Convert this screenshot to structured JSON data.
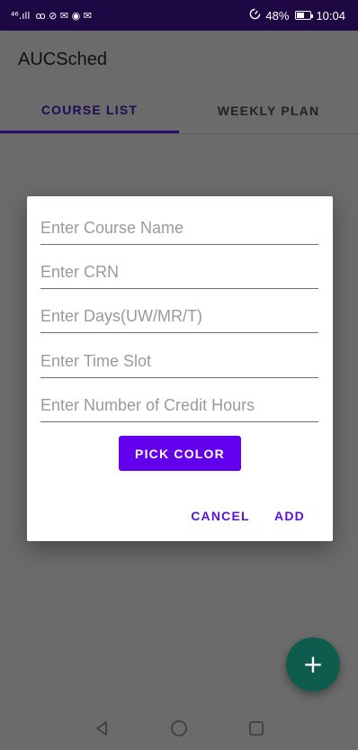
{
  "status_bar": {
    "network": "⁴⁶.ıll",
    "notification_icons": "ꝏ ⊘ ✉ ◉ ✉",
    "battery_percent": "48%",
    "time": "10:04"
  },
  "app": {
    "title": "AUCSched"
  },
  "tabs": [
    {
      "label": "COURSE LIST",
      "active": true
    },
    {
      "label": "WEEKLY PLAN",
      "active": false
    }
  ],
  "dialog": {
    "fields": [
      {
        "placeholder": "Enter Course Name",
        "value": ""
      },
      {
        "placeholder": "Enter CRN",
        "value": ""
      },
      {
        "placeholder": "Enter Days(UW/MR/T)",
        "value": ""
      },
      {
        "placeholder": "Enter Time Slot",
        "value": ""
      },
      {
        "placeholder": "Enter Number of Credit Hours",
        "value": ""
      }
    ],
    "pick_color_label": "PICK COLOR",
    "cancel_label": "CANCEL",
    "add_label": "ADD"
  },
  "fab": {
    "icon": "plus-icon",
    "glyph": "+"
  },
  "colors": {
    "accent": "#6200ee",
    "fab": "#0d5c4d",
    "status_bar": "#1e0844"
  }
}
